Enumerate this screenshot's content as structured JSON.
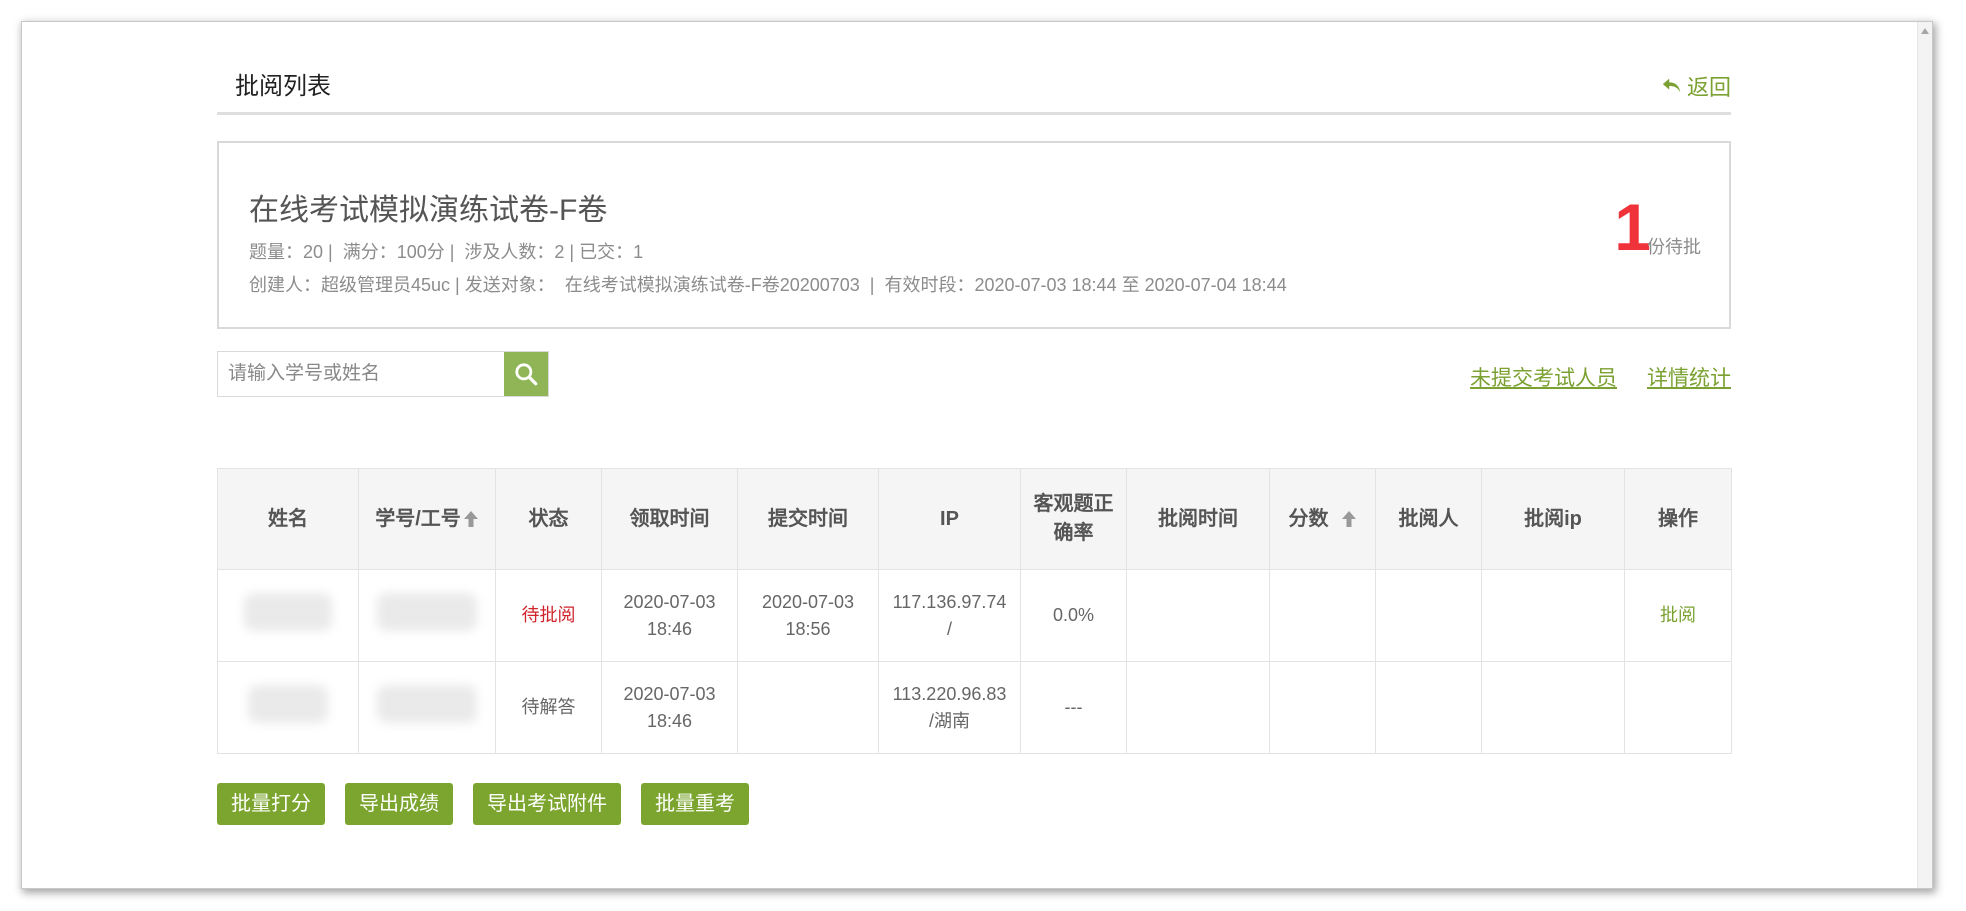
{
  "header": {
    "title": "批阅列表",
    "back_label": "返回"
  },
  "exam": {
    "title": "在线考试模拟演练试卷-F卷",
    "meta_line1": "题量：20 |  满分：100分 |  涉及人数：2 | 已交：1",
    "meta_line2": "创建人：超级管理员45uc | 发送对象：  在线考试模拟演练试卷-F卷20200703  |  有效时段：2020-07-03 18:44 至 2020-07-04 18:44",
    "pending_count": "1",
    "pending_label": "份待批"
  },
  "search": {
    "placeholder": "请输入学号或姓名"
  },
  "links": {
    "unsubmitted": "未提交考试人员",
    "stats": "详情统计"
  },
  "table": {
    "columns": [
      "姓名",
      "学号/工号",
      "状态",
      "领取时间",
      "提交时间",
      "IP",
      "客观题正确率",
      "批阅时间",
      "分数",
      "批阅人",
      "批阅ip",
      "操作"
    ],
    "rows": [
      {
        "name": "",
        "id": "",
        "status": "待批阅",
        "receive_time_date": "2020-07-03",
        "receive_time_clock": "18:46",
        "submit_time_date": "2020-07-03",
        "submit_time_clock": "18:56",
        "ip_line1": "117.136.97.74",
        "ip_line2": "/",
        "accuracy": "0.0%",
        "review_time": "",
        "score": "",
        "reviewer": "",
        "reviewer_ip": "",
        "action": "批阅"
      },
      {
        "name": "",
        "id": "",
        "status": "待解答",
        "receive_time_date": "2020-07-03",
        "receive_time_clock": "18:46",
        "submit_time_date": "",
        "submit_time_clock": "",
        "ip_line1": "113.220.96.83",
        "ip_line2": "/湖南",
        "accuracy": "---",
        "review_time": "",
        "score": "",
        "reviewer": "",
        "reviewer_ip": "",
        "action": ""
      }
    ]
  },
  "buttons": {
    "batch_score": "批量打分",
    "export_scores": "导出成绩",
    "export_attachments": "导出考试附件",
    "batch_retake": "批量重考"
  },
  "colors": {
    "accent": "#7ba52f",
    "link": "#7aa131",
    "alert": "#f0333a",
    "status_pending": "#d0232b"
  }
}
